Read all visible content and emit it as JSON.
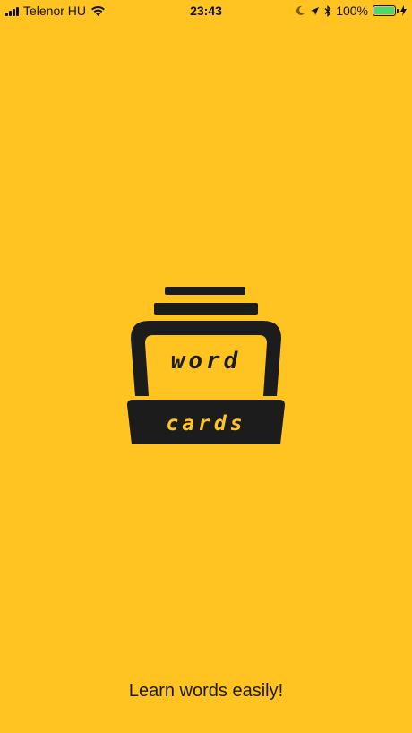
{
  "status_bar": {
    "carrier": "Telenor HU",
    "time": "23:43",
    "battery_percent": "100%",
    "battery_level": 1.0,
    "battery_color": "#4CD964",
    "icons": [
      "signal-icon",
      "wifi-icon",
      "moon-icon",
      "location-icon",
      "bluetooth-icon",
      "battery-icon",
      "charging-icon"
    ]
  },
  "logo": {
    "top_word": "word",
    "bottom_word": "cards"
  },
  "tagline": "Learn words easily!",
  "colors": {
    "background": "#FFC422",
    "logo_dark": "#1C1C1C"
  }
}
